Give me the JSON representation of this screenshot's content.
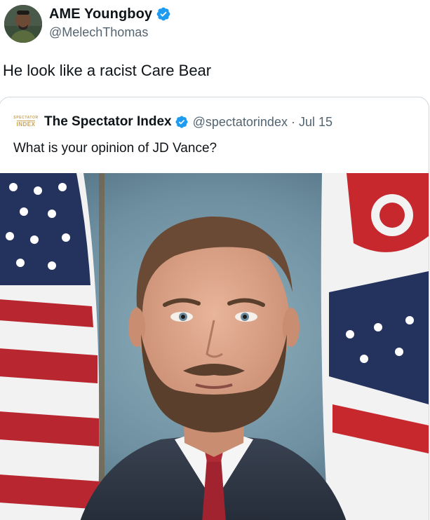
{
  "tweet": {
    "author_name": "AME Youngboy",
    "author_handle": "@MelechThomas",
    "text": "He look like a racist Care Bear",
    "verified_color": "#1d9bf0",
    "avatar_icon": "profile-photo"
  },
  "quoted_tweet": {
    "logo_line1": "SPECTATOR",
    "logo_line2": "INDEX",
    "author_name": "The Spectator Index",
    "author_handle": "@spectatorindex",
    "separator": "·",
    "date": "Jul 15",
    "text": "What is your opinion of JD Vance?",
    "image_icon": "portrait-photo-with-flags"
  },
  "colors": {
    "text": "#0f1419",
    "secondary_text": "#536471",
    "border": "#cfd9de",
    "logo_gold": "#c9a24d"
  }
}
